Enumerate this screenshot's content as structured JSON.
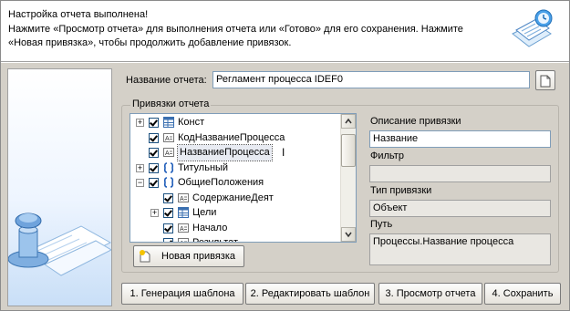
{
  "header": {
    "title": "Настройка отчета выполнена!",
    "message": "Нажмите «Просмотр отчета» для выполнения отчета или «Готово» для его сохранения. Нажмите «Новая привязка», чтобы продолжить добавление привязок."
  },
  "report_name": {
    "label": "Название отчета:",
    "value": "Регламент процесса IDEF0"
  },
  "bindings": {
    "group_label": "Привязки отчета",
    "tree": [
      {
        "label": "Конст",
        "icon": "table-icon",
        "expander": "+",
        "checked": true
      },
      {
        "label": "КодНазваниеПроцесса",
        "icon": "text-field-icon",
        "expander": "",
        "checked": true
      },
      {
        "label": "НазваниеПроцесса",
        "icon": "text-field-icon",
        "expander": "",
        "checked": true,
        "selected": true
      },
      {
        "label": "Титульный",
        "icon": "bracket-icon",
        "expander": "+",
        "checked": true
      },
      {
        "label": "ОбщиеПоложения",
        "icon": "bracket-icon",
        "expander": "−",
        "checked": true
      },
      {
        "label": "СодержаниеДеят",
        "icon": "text-field-icon",
        "expander": "",
        "checked": true
      },
      {
        "label": "Цели",
        "icon": "table-icon",
        "expander": "+",
        "checked": true
      },
      {
        "label": "Начало",
        "icon": "text-field-icon",
        "expander": "",
        "checked": true
      },
      {
        "label": "Результат",
        "icon": "text-field-icon",
        "expander": "",
        "checked": true
      }
    ],
    "new_binding_button": "Новая привязка"
  },
  "details": {
    "description_label": "Описание привязки",
    "description_value": "Название",
    "filter_label": "Фильтр",
    "filter_value": "",
    "type_label": "Тип привязки",
    "type_value": "Объект",
    "path_label": "Путь",
    "path_value": "Процессы.Название процесса"
  },
  "footer_buttons": {
    "generate": "1. Генерация шаблона",
    "edit": "2. Редактировать шаблон",
    "preview": "3. Просмотр отчета",
    "save": "4. Сохранить"
  }
}
